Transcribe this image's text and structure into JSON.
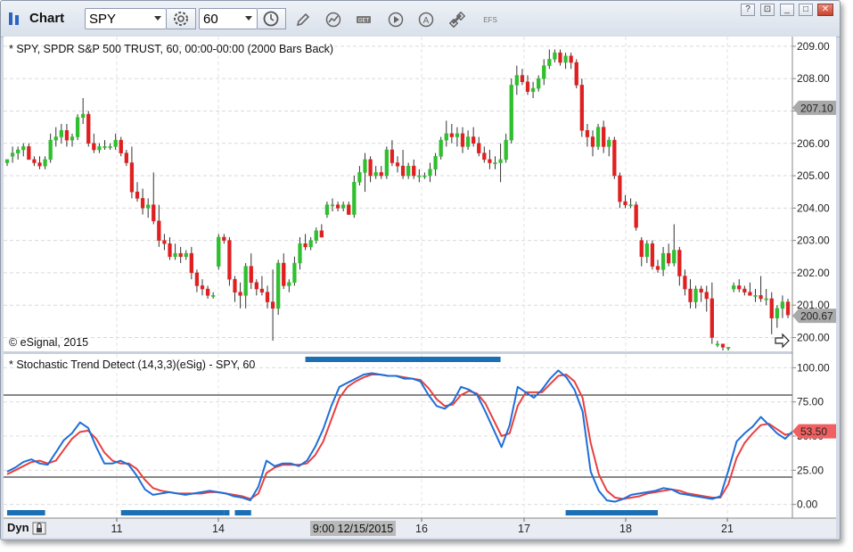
{
  "window": {
    "title": "Chart",
    "symbol": "SPY",
    "interval": "60",
    "toolbar_icons": [
      "symbol-settings-icon",
      "interval-clock-icon",
      "pencil-draw-icon",
      "line-tools-icon",
      "get-data-icon",
      "play-replay-icon",
      "alerts-icon",
      "link-icon",
      "efs-icon"
    ],
    "efs_label": "EFS",
    "window_buttons": [
      "?",
      "⊡",
      "_",
      "□",
      "✕"
    ]
  },
  "price_panel": {
    "header": "* SPY, SPDR S&P 500 TRUST, 60, 00:00-00:00 (2000 Bars Back)",
    "copyright": "© eSignal, 2015",
    "y_ticks": [
      "209.00",
      "208.00",
      "207.00",
      "206.00",
      "205.00",
      "204.00",
      "203.00",
      "202.00",
      "201.00",
      "200.00"
    ],
    "marker_high": "207.10",
    "marker_last": "200.67"
  },
  "indicator_panel": {
    "header": "* Stochastic Trend Detect (14,3,3)(eSig) - SPY, 60",
    "y_ticks": [
      "100.00",
      "75.00",
      "50.00",
      "25.00",
      "0.00"
    ],
    "marker_last": "53.50",
    "overbought": 80,
    "oversold": 20
  },
  "x_axis": {
    "mode_label": "Dyn",
    "labels": [
      "11",
      "14",
      "16",
      "17",
      "18",
      "21"
    ],
    "cursor_label": "9:00 12/15/2015"
  },
  "colors": {
    "up": "#2fbf2f",
    "down": "#e02020",
    "stoch_k": "#1e6fd8",
    "stoch_d": "#e84040",
    "trend_bar": "#1a6fb5",
    "marker": "#a9a9a9",
    "marker_red": "#f06060"
  },
  "chart_data": [
    {
      "type": "candlestick",
      "title": "* SPY, SPDR S&P 500 TRUST, 60, 00:00-00:00 (2000 Bars Back)",
      "ylim": [
        199.6,
        209.3
      ],
      "bars": [
        [
          205.4,
          205.5,
          205.3,
          205.5
        ],
        [
          205.6,
          205.9,
          205.4,
          205.7
        ],
        [
          205.7,
          205.9,
          205.5,
          205.8
        ],
        [
          205.8,
          206.0,
          205.6,
          205.9
        ],
        [
          205.9,
          206.0,
          205.5,
          205.5
        ],
        [
          205.5,
          205.6,
          205.3,
          205.4
        ],
        [
          205.4,
          205.6,
          205.2,
          205.3
        ],
        [
          205.3,
          205.6,
          205.2,
          205.5
        ],
        [
          205.5,
          206.3,
          205.4,
          206.1
        ],
        [
          206.1,
          206.5,
          205.9,
          206.2
        ],
        [
          206.2,
          206.6,
          206.0,
          206.4
        ],
        [
          206.4,
          206.6,
          205.9,
          206.1
        ],
        [
          206.1,
          206.3,
          205.9,
          206.2
        ],
        [
          206.2,
          206.9,
          206.1,
          206.8
        ],
        [
          206.8,
          207.4,
          206.6,
          206.9
        ],
        [
          206.9,
          207.0,
          205.9,
          206.0
        ],
        [
          206.0,
          206.3,
          205.7,
          205.8
        ],
        [
          205.8,
          206.0,
          205.7,
          205.9
        ],
        [
          205.9,
          206.1,
          205.8,
          205.9
        ],
        [
          205.9,
          206.0,
          205.8,
          205.9
        ],
        [
          205.9,
          206.3,
          205.8,
          206.1
        ],
        [
          206.1,
          206.2,
          205.6,
          205.7
        ],
        [
          205.7,
          205.8,
          205.3,
          205.4
        ],
        [
          205.4,
          205.9,
          204.3,
          204.5
        ],
        [
          204.5,
          204.8,
          204.2,
          204.3
        ],
        [
          204.3,
          204.6,
          203.8,
          204.0
        ],
        [
          204.0,
          204.3,
          203.7,
          204.1
        ],
        [
          204.1,
          205.1,
          203.5,
          203.6
        ],
        [
          203.6,
          204.1,
          202.8,
          203.0
        ],
        [
          203.0,
          203.2,
          202.7,
          202.9
        ],
        [
          202.9,
          203.1,
          202.4,
          202.5
        ],
        [
          202.5,
          202.9,
          202.4,
          202.6
        ],
        [
          202.6,
          202.8,
          202.3,
          202.5
        ],
        [
          202.5,
          202.7,
          202.4,
          202.6
        ],
        [
          202.6,
          202.8,
          201.8,
          202.0
        ],
        [
          202.0,
          202.1,
          201.4,
          201.6
        ],
        [
          201.6,
          201.8,
          201.3,
          201.5
        ],
        [
          201.5,
          201.6,
          201.2,
          201.3
        ],
        [
          201.3,
          201.4,
          201.2,
          201.3
        ],
        [
          202.2,
          203.2,
          202.1,
          203.1
        ],
        [
          203.1,
          203.2,
          202.9,
          203.0
        ],
        [
          203.0,
          203.1,
          201.6,
          201.8
        ],
        [
          201.8,
          201.9,
          201.1,
          201.4
        ],
        [
          201.4,
          201.7,
          200.9,
          201.3
        ],
        [
          201.3,
          202.3,
          200.9,
          202.2
        ],
        [
          202.2,
          202.6,
          201.5,
          201.7
        ],
        [
          201.7,
          201.8,
          201.3,
          201.5
        ],
        [
          201.5,
          201.9,
          201.3,
          201.4
        ],
        [
          201.4,
          201.6,
          200.9,
          201.1
        ],
        [
          201.1,
          202.1,
          199.9,
          200.9
        ],
        [
          200.9,
          202.4,
          200.7,
          202.3
        ],
        [
          202.3,
          202.6,
          201.5,
          201.6
        ],
        [
          201.6,
          201.8,
          201.4,
          201.7
        ],
        [
          201.7,
          202.5,
          201.6,
          202.3
        ],
        [
          202.3,
          203.1,
          202.1,
          202.9
        ],
        [
          202.9,
          203.2,
          202.7,
          202.8
        ],
        [
          202.8,
          203.1,
          202.7,
          203.0
        ],
        [
          203.0,
          203.4,
          202.9,
          203.3
        ],
        [
          203.3,
          203.5,
          203.1,
          203.1
        ],
        [
          203.8,
          204.2,
          203.7,
          204.1
        ],
        [
          204.1,
          204.3,
          203.9,
          204.1
        ],
        [
          204.1,
          204.2,
          203.9,
          204.0
        ],
        [
          204.0,
          204.2,
          203.9,
          204.1
        ],
        [
          204.1,
          204.2,
          203.8,
          203.8
        ],
        [
          203.8,
          205.0,
          203.7,
          204.8
        ],
        [
          204.8,
          205.3,
          204.7,
          205.1
        ],
        [
          205.1,
          205.7,
          204.5,
          205.5
        ],
        [
          205.5,
          205.6,
          204.8,
          205.0
        ],
        [
          205.0,
          205.3,
          204.9,
          205.1
        ],
        [
          205.1,
          205.3,
          204.9,
          205.0
        ],
        [
          205.0,
          205.9,
          204.9,
          205.8
        ],
        [
          205.8,
          206.1,
          205.3,
          205.4
        ],
        [
          205.4,
          205.6,
          205.1,
          205.3
        ],
        [
          205.3,
          205.8,
          204.9,
          205.0
        ],
        [
          205.0,
          205.4,
          204.9,
          205.3
        ],
        [
          205.3,
          205.5,
          204.9,
          205.0
        ],
        [
          205.0,
          205.2,
          204.8,
          205.0
        ],
        [
          205.0,
          205.1,
          204.9,
          205.0
        ],
        [
          205.0,
          205.4,
          204.8,
          205.2
        ],
        [
          205.2,
          205.7,
          205.0,
          205.6
        ],
        [
          205.6,
          206.2,
          205.5,
          206.1
        ],
        [
          206.1,
          206.7,
          205.9,
          206.3
        ],
        [
          206.3,
          206.6,
          206.0,
          206.2
        ],
        [
          206.2,
          206.5,
          205.9,
          206.3
        ],
        [
          206.3,
          206.5,
          205.7,
          205.9
        ],
        [
          205.9,
          206.4,
          205.8,
          206.2
        ],
        [
          206.2,
          206.5,
          205.9,
          206.0
        ],
        [
          206.0,
          206.2,
          205.6,
          205.7
        ],
        [
          205.7,
          205.9,
          205.4,
          205.5
        ],
        [
          205.5,
          205.8,
          205.2,
          205.4
        ],
        [
          205.4,
          205.6,
          205.2,
          205.4
        ],
        [
          205.4,
          206.0,
          204.8,
          205.5
        ],
        [
          205.5,
          206.3,
          205.4,
          206.1
        ],
        [
          206.1,
          208.0,
          206.0,
          207.8
        ],
        [
          207.8,
          208.4,
          207.5,
          208.1
        ],
        [
          208.1,
          208.3,
          207.8,
          207.9
        ],
        [
          207.9,
          208.1,
          207.5,
          207.6
        ],
        [
          207.6,
          207.9,
          207.4,
          207.7
        ],
        [
          207.7,
          208.1,
          207.6,
          208.0
        ],
        [
          208.0,
          208.6,
          207.8,
          208.4
        ],
        [
          208.4,
          208.9,
          208.3,
          208.6
        ],
        [
          208.6,
          208.9,
          208.5,
          208.8
        ],
        [
          208.8,
          208.9,
          208.4,
          208.5
        ],
        [
          208.5,
          208.8,
          208.3,
          208.7
        ],
        [
          208.7,
          208.8,
          208.3,
          208.5
        ],
        [
          208.5,
          208.6,
          207.7,
          207.8
        ],
        [
          207.8,
          208.0,
          206.2,
          206.4
        ],
        [
          206.4,
          206.6,
          205.9,
          206.2
        ],
        [
          206.2,
          206.4,
          205.6,
          205.9
        ],
        [
          205.9,
          206.6,
          205.8,
          206.5
        ],
        [
          206.5,
          206.7,
          205.7,
          205.9
        ],
        [
          205.9,
          206.2,
          205.6,
          206.1
        ],
        [
          206.1,
          206.2,
          204.9,
          205.0
        ],
        [
          205.0,
          205.1,
          204.0,
          204.2
        ],
        [
          204.2,
          204.4,
          204.0,
          204.1
        ],
        [
          204.1,
          204.3,
          204.0,
          204.1
        ],
        [
          204.1,
          204.2,
          203.3,
          203.4
        ],
        [
          203.0,
          203.1,
          202.2,
          202.5
        ],
        [
          202.5,
          203.0,
          202.3,
          202.9
        ],
        [
          202.9,
          203.0,
          202.1,
          202.2
        ],
        [
          202.2,
          202.4,
          202.0,
          202.1
        ],
        [
          202.1,
          202.8,
          201.9,
          202.6
        ],
        [
          202.6,
          202.9,
          202.2,
          202.3
        ],
        [
          202.3,
          203.5,
          202.2,
          202.7
        ],
        [
          202.7,
          202.8,
          201.6,
          201.9
        ],
        [
          201.9,
          202.1,
          201.3,
          201.5
        ],
        [
          201.5,
          201.8,
          200.9,
          201.1
        ],
        [
          201.1,
          201.6,
          200.9,
          201.5
        ],
        [
          201.5,
          201.6,
          201.1,
          201.4
        ],
        [
          201.4,
          201.6,
          200.8,
          201.2
        ],
        [
          201.2,
          201.7,
          199.8,
          200.0
        ],
        [
          199.8,
          199.9,
          199.7,
          199.8
        ],
        [
          199.8,
          199.8,
          199.6,
          199.7
        ],
        [
          199.7,
          199.7,
          199.6,
          199.7
        ],
        [
          201.5,
          201.7,
          201.4,
          201.6
        ],
        [
          201.6,
          201.8,
          201.4,
          201.5
        ],
        [
          201.5,
          201.6,
          201.3,
          201.4
        ],
        [
          201.4,
          201.7,
          201.3,
          201.3
        ],
        [
          201.3,
          201.5,
          201.1,
          201.3
        ],
        [
          201.3,
          201.9,
          201.1,
          201.2
        ],
        [
          201.2,
          201.5,
          201.0,
          201.2
        ],
        [
          201.2,
          201.4,
          200.1,
          200.6
        ],
        [
          200.6,
          201.0,
          200.3,
          200.9
        ],
        [
          200.9,
          201.3,
          200.6,
          201.1
        ],
        [
          201.1,
          201.2,
          200.6,
          200.7
        ]
      ]
    },
    {
      "type": "line",
      "title": "* Stochastic Trend Detect (14,3,3)(eSig) - SPY, 60",
      "ylim": [
        -10,
        110
      ],
      "series": [
        {
          "name": "%K",
          "values": [
            24,
            27,
            31,
            33,
            30,
            29,
            38,
            47,
            52,
            60,
            56,
            42,
            30,
            30,
            32,
            29,
            21,
            11,
            7,
            8,
            9,
            8,
            7,
            8,
            9,
            10,
            9,
            8,
            6,
            5,
            3,
            13,
            32,
            28,
            30,
            30,
            28,
            32,
            42,
            55,
            72,
            86,
            89,
            92,
            95,
            96,
            95,
            94,
            94,
            92,
            92,
            90,
            80,
            72,
            70,
            75,
            86,
            84,
            80,
            68,
            55,
            42,
            58,
            86,
            82,
            78,
            84,
            92,
            98,
            93,
            84,
            68,
            24,
            10,
            3,
            2,
            4,
            7,
            8,
            9,
            10,
            12,
            11,
            8,
            7,
            6,
            5,
            4,
            6,
            25,
            46,
            52,
            57,
            64,
            58,
            52,
            48,
            54
          ]
        },
        {
          "name": "%D",
          "values": [
            22,
            25,
            28,
            31,
            32,
            30,
            32,
            40,
            48,
            53,
            54,
            48,
            38,
            32,
            30,
            30,
            26,
            18,
            12,
            10,
            9,
            8,
            8,
            8,
            8,
            9,
            9,
            8,
            7,
            6,
            4,
            8,
            23,
            27,
            29,
            29,
            29,
            30,
            36,
            46,
            62,
            78,
            86,
            90,
            93,
            95,
            95,
            94,
            94,
            93,
            92,
            91,
            85,
            77,
            72,
            73,
            80,
            83,
            81,
            74,
            62,
            50,
            52,
            72,
            82,
            82,
            82,
            88,
            94,
            95,
            90,
            78,
            45,
            22,
            10,
            5,
            4,
            5,
            6,
            8,
            9,
            10,
            11,
            10,
            8,
            7,
            6,
            5,
            5,
            15,
            34,
            45,
            52,
            58,
            59,
            55,
            51,
            52
          ]
        }
      ],
      "reference_lines": [
        80,
        20
      ]
    }
  ]
}
